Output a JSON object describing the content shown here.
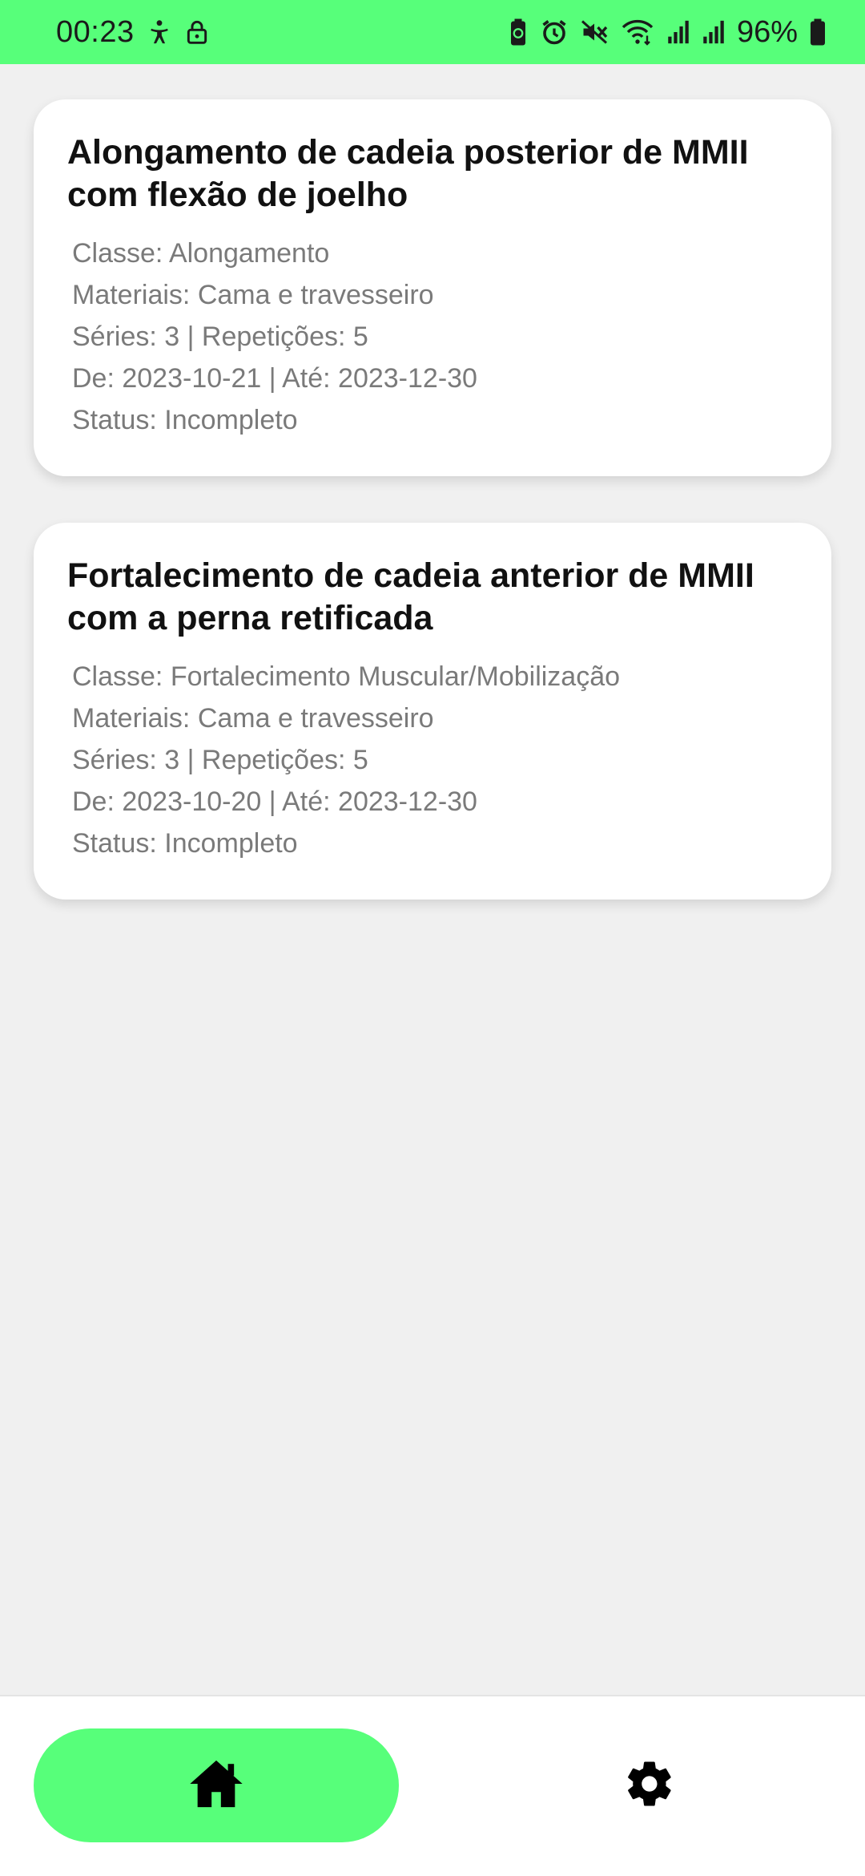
{
  "status_bar": {
    "time": "00:23",
    "battery_percent": "96%",
    "left_icons": [
      "accessibility-icon",
      "lock-icon"
    ],
    "right_icons": [
      "battery-saver-icon",
      "alarm-icon",
      "mute-icon",
      "wifi-icon",
      "signal-icon",
      "signal-icon",
      "battery-icon"
    ],
    "background_color": "#57ff7a"
  },
  "exercises": [
    {
      "title": "Alongamento de cadeia posterior de MMII com flexão de joelho",
      "class_line": "Classe: Alongamento",
      "materials_line": "Materiais: Cama e travesseiro",
      "series_line": "Séries: 3 | Repetições: 5",
      "dates_line": "De: 2023-10-21 | Até: 2023-12-30",
      "status_line": "Status: Incompleto"
    },
    {
      "title": "Fortalecimento de cadeia anterior de MMII com a perna retificada",
      "class_line": "Classe: Fortalecimento Muscular/Mobilização",
      "materials_line": "Materiais: Cama e travesseiro",
      "series_line": "Séries: 3 | Repetições: 5",
      "dates_line": "De: 2023-10-20 | Até: 2023-12-30",
      "status_line": "Status: Incompleto"
    }
  ],
  "bottom_nav": {
    "items": [
      {
        "icon": "home-icon",
        "selected": true
      },
      {
        "icon": "gear-icon",
        "selected": false
      }
    ],
    "accent_color": "#57ff7a"
  }
}
